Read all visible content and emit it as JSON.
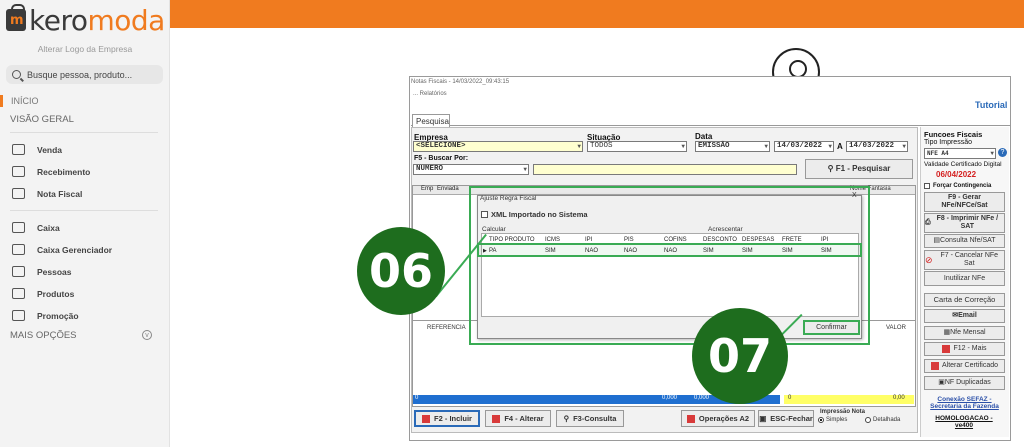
{
  "brand": {
    "logo_prefix": "kero",
    "logo_suffix": "moda",
    "alter_logo": "Alterar Logo da Empresa",
    "bag_letter": "m"
  },
  "search": {
    "placeholder": "Busque pessoa, produto..."
  },
  "nav": {
    "inicio": "INÍCIO",
    "visao_geral": "VISÃO GERAL",
    "group1": [
      "Venda",
      "Recebimento",
      "Nota Fiscal"
    ],
    "group2": [
      "Caixa",
      "Caixa Gerenciador",
      "Pessoas",
      "Produtos",
      "Promoção"
    ],
    "mais_opcoes": "MAIS OPÇÕES"
  },
  "window": {
    "title": "Notas Fiscais - 14/03/2022_09:43:15",
    "menu": "...   Relatórios",
    "tutorial": "Tutorial",
    "tab": "Pesquisa"
  },
  "filters": {
    "empresa_label": "Empresa",
    "empresa_value": "<SELECIONE>",
    "situacao_label": "Situação",
    "situacao_value": "TODOS",
    "data_label": "Data",
    "data_type": "EMISSÃO",
    "date_from": "14/03/2022",
    "date_sep": "A",
    "date_to": "14/03/2022",
    "buscar_label": "F5 - Buscar Por:",
    "buscar_value": "NUMERO",
    "pesquisar_button": "F1 - Pesquisar"
  },
  "grid": {
    "head_emp": "Emp",
    "head_enviada": "Enviada",
    "head_nome_fantasia": "Nome Fantasia",
    "lower_referencia": "REFERENCIA",
    "lower_valor": "VALOR",
    "totals": [
      "0",
      "0,000",
      "0,000",
      "0",
      "0,00"
    ]
  },
  "bottom_buttons": [
    "F2 - Incluir",
    "F4 - Alterar",
    "F3-Consulta",
    "Operações A2",
    "ESC-Fechar"
  ],
  "impressao": {
    "label": "Impressão Nota",
    "simples": "Simples",
    "detalhada": "Detalhada"
  },
  "right_panel": {
    "funcoes": "Funcoes Fiscais",
    "tipo_impressao": "Tipo Impressão",
    "tipo_value": "NFE A4",
    "validade_label": "Validade Certificado Digital",
    "validade_date": "06/04/2022",
    "forcar": "Forçar Contingencia",
    "buttons": [
      "F9 - Gerar NFe/NFCe/Sat",
      "F8 - Imprimir NFe / SAT",
      "Consulta Nfe/SAT",
      "F7 - Cancelar NFe Sat",
      "Inutilizar NFe",
      "Carta de Correção",
      "Email",
      "Nfe Mensal",
      "F12 - Mais",
      "Alterar Certificado",
      "NF Duplicadas"
    ],
    "sefaz": "Conexão SEFAZ - Secretaria da Fazenda",
    "ambiente": "HOMOLOGACAO - ve400"
  },
  "dialog": {
    "title": "Ajuste Regra Fiscal",
    "close": "X",
    "xml_checkbox": "XML Importado no Sistema",
    "calcular": "Calcular",
    "acrescentar": "Acrescentar",
    "headers": [
      "TIPO PRODUTO",
      "ICMS",
      "IPI",
      "PIS",
      "COFINS",
      "DESCONTO",
      "DESPESAS",
      "FRETE",
      "IPI"
    ],
    "row": [
      "PA",
      "SIM",
      "NAO",
      "NAO",
      "NAO",
      "SIM",
      "SIM",
      "SIM",
      "SIM"
    ],
    "confirmar": "Confirmar"
  },
  "annotations": {
    "badge1": "06",
    "badge2": "07"
  },
  "colors": {
    "brand_orange": "#f07b1f",
    "highlight_green": "#3aab54",
    "badge_green": "#1e6d1e"
  }
}
